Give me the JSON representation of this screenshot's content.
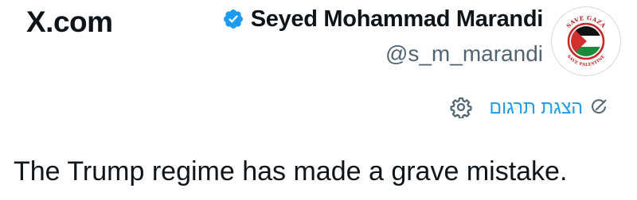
{
  "brand": {
    "site": "X.com"
  },
  "profile": {
    "display_name": "Seyed Mohammad Marandi",
    "handle": "@s_m_marandi",
    "verified": true,
    "avatar_text": {
      "top": "SAVE GAZA",
      "bottom": "SAVE PALESTINE"
    }
  },
  "translate": {
    "label": "הצגת תרגום",
    "link_color": "#1d9bf0"
  },
  "tweet": {
    "text": "The Trump regime has made a grave mistake."
  },
  "icons": {
    "verified": "verified-badge-icon",
    "gear": "gear-icon",
    "translate": "translate-icon"
  },
  "colors": {
    "text": "#0f1419",
    "secondary": "#536471",
    "accent": "#1d9bf0"
  }
}
